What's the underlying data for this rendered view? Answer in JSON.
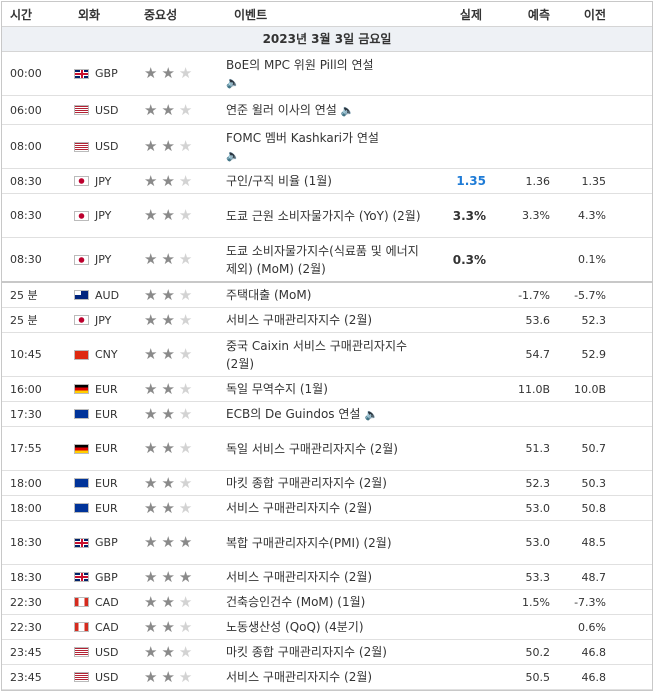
{
  "header": {
    "time": "시간",
    "currency": "외화",
    "importance": "중요성",
    "event": "이벤트",
    "actual": "실제",
    "forecast": "예측",
    "previous": "이전"
  },
  "date_label": "2023년 3월 3일 금요일",
  "speaker_icon": "speaker-icon",
  "rows": [
    {
      "time": "00:00",
      "cur": "GBP",
      "flag": "uk",
      "stars": 2,
      "event": "BoE의 MPC 위원 Pill의 연설",
      "speaker": "block",
      "actual": "",
      "forecast": "",
      "previous": ""
    },
    {
      "time": "06:00",
      "cur": "USD",
      "flag": "us",
      "stars": 2,
      "event": "연준 윌러 이사의 연설",
      "speaker": "inline",
      "actual": "",
      "forecast": "",
      "previous": ""
    },
    {
      "time": "08:00",
      "cur": "USD",
      "flag": "us",
      "stars": 2,
      "event": "FOMC 멤버 Kashkari가 연설",
      "speaker": "block",
      "actual": "",
      "forecast": "",
      "previous": ""
    },
    {
      "time": "08:30",
      "cur": "JPY",
      "flag": "jp",
      "stars": 2,
      "event": "구인/구직 비율 (1월)",
      "actual": "1.35",
      "actual_color": "blue",
      "forecast": "1.36",
      "previous": "1.35"
    },
    {
      "time": "08:30",
      "cur": "JPY",
      "flag": "jp",
      "stars": 2,
      "event": "도쿄 근원 소비자물가지수 (YoY) (2월)",
      "actual": "3.3%",
      "forecast": "3.3%",
      "previous": "4.3%"
    },
    {
      "time": "08:30",
      "cur": "JPY",
      "flag": "jp",
      "stars": 2,
      "event": "도쿄 소비자물가지수(식료품 및 에너지 제외) (MoM) (2월)",
      "actual": "0.3%",
      "forecast": "",
      "previous": "0.1%",
      "sep": true
    },
    {
      "time": "25 분",
      "cur": "AUD",
      "flag": "au",
      "stars": 2,
      "event": "주택대출 (MoM)",
      "actual": "",
      "forecast": "-1.7%",
      "previous": "-5.7%"
    },
    {
      "time": "25 분",
      "cur": "JPY",
      "flag": "jp",
      "stars": 2,
      "event": "서비스 구매관리자지수 (2월)",
      "actual": "",
      "forecast": "53.6",
      "previous": "52.3"
    },
    {
      "time": "10:45",
      "cur": "CNY",
      "flag": "cn",
      "stars": 2,
      "event": "중국 Caixin 서비스 구매관리자지수 (2월)",
      "actual": "",
      "forecast": "54.7",
      "previous": "52.9"
    },
    {
      "time": "16:00",
      "cur": "EUR",
      "flag": "de",
      "stars": 2,
      "event": "독일 무역수지 (1월)",
      "actual": "",
      "forecast": "11.0B",
      "previous": "10.0B"
    },
    {
      "time": "17:30",
      "cur": "EUR",
      "flag": "eu",
      "stars": 2,
      "event": "ECB의 De Guindos 연설",
      "speaker": "inline",
      "actual": "",
      "forecast": "",
      "previous": ""
    },
    {
      "time": "17:55",
      "cur": "EUR",
      "flag": "de",
      "stars": 2,
      "event": "독일 서비스 구매관리자지수 (2월)",
      "actual": "",
      "forecast": "51.3",
      "previous": "50.7"
    },
    {
      "time": "18:00",
      "cur": "EUR",
      "flag": "eu",
      "stars": 2,
      "event": "마킷 종합 구매관리자지수 (2월)",
      "actual": "",
      "forecast": "52.3",
      "previous": "50.3"
    },
    {
      "time": "18:00",
      "cur": "EUR",
      "flag": "eu",
      "stars": 2,
      "event": "서비스 구매관리자지수 (2월)",
      "actual": "",
      "forecast": "53.0",
      "previous": "50.8"
    },
    {
      "time": "18:30",
      "cur": "GBP",
      "flag": "uk",
      "stars": 3,
      "event": "복합 구매관리자지수(PMI) (2월)",
      "actual": "",
      "forecast": "53.0",
      "previous": "48.5"
    },
    {
      "time": "18:30",
      "cur": "GBP",
      "flag": "uk",
      "stars": 3,
      "event": "서비스 구매관리자지수 (2월)",
      "actual": "",
      "forecast": "53.3",
      "previous": "48.7"
    },
    {
      "time": "22:30",
      "cur": "CAD",
      "flag": "ca",
      "stars": 2,
      "event": "건축승인건수 (MoM) (1월)",
      "actual": "",
      "forecast": "1.5%",
      "previous": "-7.3%"
    },
    {
      "time": "22:30",
      "cur": "CAD",
      "flag": "ca",
      "stars": 2,
      "event": "노동생산성 (QoQ) (4분기)",
      "actual": "",
      "forecast": "",
      "previous": "0.6%"
    },
    {
      "time": "23:45",
      "cur": "USD",
      "flag": "us",
      "stars": 2,
      "event": "마킷 종합 구매관리자지수 (2월)",
      "actual": "",
      "forecast": "50.2",
      "previous": "46.8"
    },
    {
      "time": "23:45",
      "cur": "USD",
      "flag": "us",
      "stars": 2,
      "event": "서비스 구매관리자지수 (2월)",
      "actual": "",
      "forecast": "50.5",
      "previous": "46.8"
    }
  ]
}
